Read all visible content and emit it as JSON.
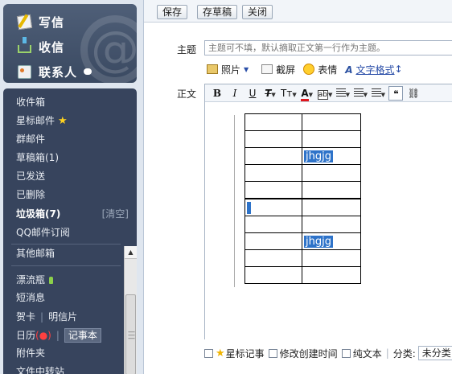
{
  "sidebar": {
    "compose_label": "写信",
    "inbox_label": "收信",
    "contacts_label": "联系人",
    "watermark": "@",
    "folders": {
      "inbox": "收件箱",
      "starred": "星标邮件",
      "group_mail": "群邮件",
      "drafts": "草稿箱(1)",
      "sent": "已发送",
      "deleted": "已删除",
      "junk": "垃圾箱(7)",
      "junk_clear": "[清空]",
      "subscriptions": "QQ邮件订阅",
      "other_mailboxes": "其他邮箱"
    },
    "apps": {
      "drift_bottle": "漂流瓶",
      "short_message": "短消息",
      "greeting_card": "贺卡",
      "postcard": "明信片",
      "calendar": "日历",
      "calendar_badge": "(●)",
      "notebook": "记事本",
      "attachments": "附件夹",
      "file_transfer": "文件中转站"
    }
  },
  "toolbar": {
    "save_label": "保存",
    "save_draft_label": "存草稿",
    "close_label": "关闭"
  },
  "compose": {
    "subject_label": "主题",
    "subject_placeholder": "主题可不填，默认摘取正文第一行作为主题。",
    "body_label": "正文",
    "attach": {
      "photo_label": "照片",
      "screenshot_label": "截屏",
      "emoticon_label": "表情",
      "text_format_label": "文字格式"
    },
    "format": {
      "bold": "B",
      "italic": "I",
      "underline": "U",
      "font": "Tт",
      "font_color": "A",
      "bg_color": "ab",
      "quote": "❝"
    }
  },
  "tables": [
    {
      "rows": [
        [
          "",
          ""
        ],
        [
          "",
          ""
        ],
        [
          "",
          "jhgjg"
        ],
        [
          "",
          ""
        ],
        [
          "",
          ""
        ]
      ]
    },
    {
      "rows": [
        [
          "",
          ""
        ],
        [
          "",
          ""
        ],
        [
          "",
          "jhgjg"
        ],
        [
          "",
          ""
        ],
        [
          "",
          ""
        ]
      ]
    }
  ],
  "options": {
    "starred_note": "星标记事",
    "modify_time": "修改创建时间",
    "plain_text": "纯文本",
    "category_label": "分类:",
    "category_value": "未分类"
  },
  "colors": {
    "sidebar_dark": "#37445d",
    "selection": "#2e73c9",
    "link": "#2a4ea8"
  }
}
